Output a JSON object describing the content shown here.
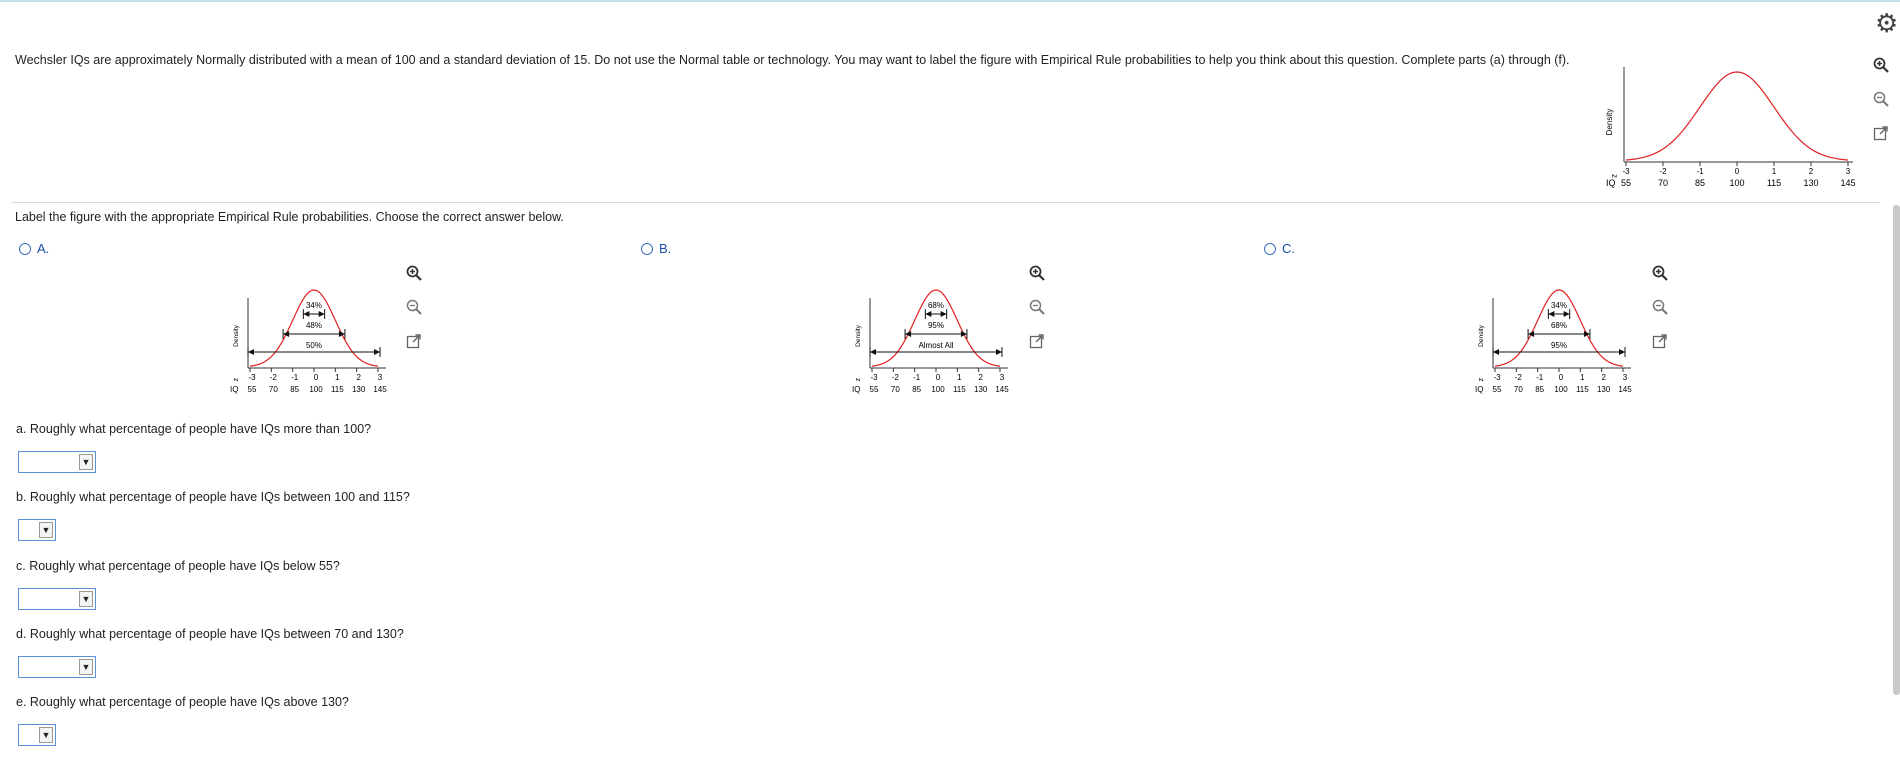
{
  "question": {
    "text": "Wechsler IQs are approximately Normally distributed with a mean of 100 and a standard deviation of 15. Do not use the Normal table or technology. You may want to label the figure with Empirical Rule probabilities to help you think about this question. Complete parts (a) through (f)."
  },
  "main_figure": {
    "ylabel": "Density",
    "z_label": "z",
    "iq_label": "IQ",
    "z_ticks": [
      "-3",
      "-2",
      "-1",
      "0",
      "1",
      "2",
      "3"
    ],
    "iq_ticks": [
      "55",
      "70",
      "85",
      "100",
      "115",
      "130",
      "145"
    ]
  },
  "instruction": "Label the figure with the appropriate Empirical Rule probabilities. Choose the correct answer below.",
  "options": [
    {
      "letter": "A.",
      "labels": [
        "34%",
        "48%",
        "50%"
      ]
    },
    {
      "letter": "B.",
      "labels": [
        "68%",
        "95%",
        "Almost All"
      ]
    },
    {
      "letter": "C.",
      "labels": [
        "34%",
        "68%",
        "95%"
      ]
    }
  ],
  "parts": [
    {
      "text": "a. Roughly what percentage of people have IQs more than 100?",
      "value": ""
    },
    {
      "text": "b. Roughly what percentage of people have IQs between 100 and 115?",
      "value": ""
    },
    {
      "text": "c. Roughly what percentage of people have IQs below 55?",
      "value": ""
    },
    {
      "text": "d. Roughly what percentage of people have IQs between 70 and 130?",
      "value": ""
    },
    {
      "text": "e. Roughly what percentage of people have IQs above 130?",
      "value": ""
    }
  ],
  "icons": {
    "settings": "gear-icon",
    "zoom_in": "zoom-in-icon",
    "zoom_out": "zoom-out-icon",
    "popout": "popout-icon"
  },
  "colors": {
    "curve": "#e02020",
    "option_link": "#1b4fa8",
    "dropdown_border": "#5b8fd6"
  }
}
